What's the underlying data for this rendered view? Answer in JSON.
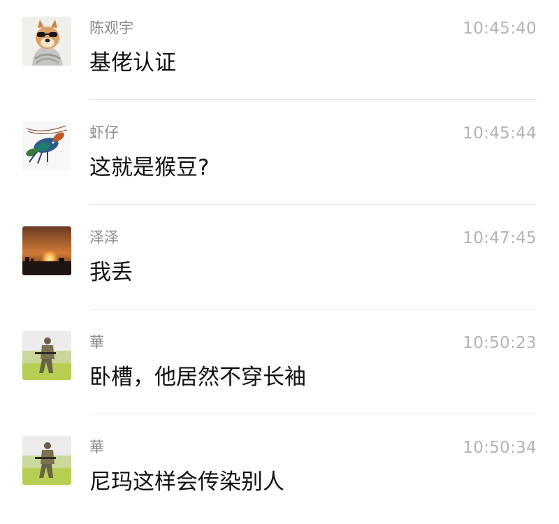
{
  "messages": [
    {
      "name": "陈观宇",
      "time": "10:45:40",
      "text": "基佬认证",
      "avatar": "dog-with-sunglasses-avatar"
    },
    {
      "name": "虾仔",
      "time": "10:45:44",
      "text": "这就是猴豆?",
      "avatar": "lobster-avatar"
    },
    {
      "name": "泽泽",
      "time": "10:47:45",
      "text": "我丢",
      "avatar": "sunset-avatar"
    },
    {
      "name": "華",
      "time": "10:50:23",
      "text": "卧槽，他居然不穿长袖",
      "avatar": "soldier-avatar"
    },
    {
      "name": "華",
      "time": "10:50:34",
      "text": "尼玛这样会传染别人",
      "avatar": "soldier-avatar"
    }
  ],
  "colors": {
    "name": "#8a8a8a",
    "time": "#b3b3b3",
    "message": "#111111",
    "divider": "#e6e6e6",
    "background": "#ffffff"
  }
}
